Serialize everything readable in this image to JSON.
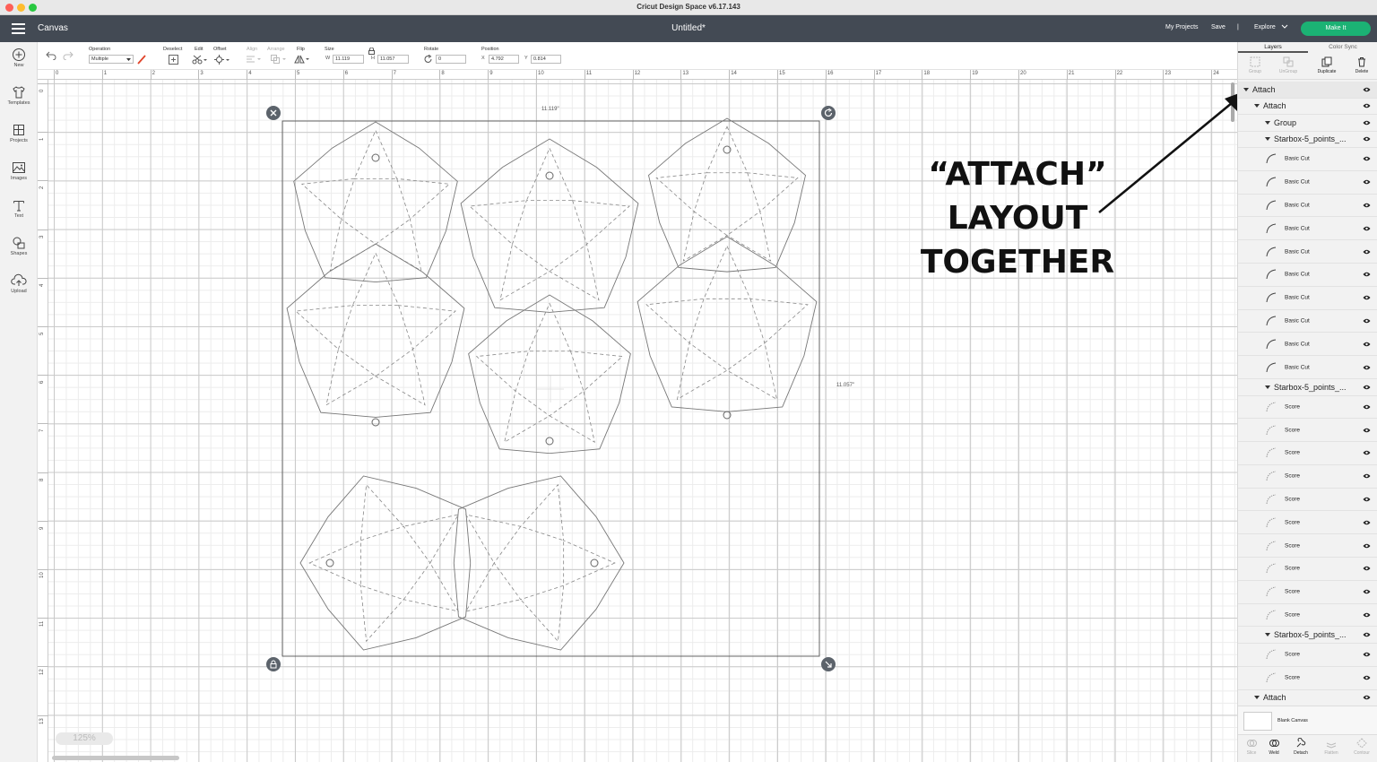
{
  "app": {
    "title": "Cricut Design Space  v6.17.143"
  },
  "topbar": {
    "canvas_label": "Canvas",
    "doc_title": "Untitled*",
    "my_projects": "My Projects",
    "save": "Save",
    "separator": "|",
    "explore": "Explore",
    "make_it": "Make It"
  },
  "sidebar": {
    "items": [
      {
        "label": "New",
        "icon": "plus-circle-icon"
      },
      {
        "label": "Templates",
        "icon": "shirt-icon"
      },
      {
        "label": "Projects",
        "icon": "projects-icon"
      },
      {
        "label": "Images",
        "icon": "image-icon"
      },
      {
        "label": "Text",
        "icon": "text-icon"
      },
      {
        "label": "Shapes",
        "icon": "shapes-icon"
      },
      {
        "label": "Upload",
        "icon": "cloud-upload-icon"
      }
    ]
  },
  "toolbar": {
    "operation_label": "Operation",
    "operation_value": "Multiple",
    "deselect": "Deselect",
    "edit": "Edit",
    "offset": "Offset",
    "align": "Align",
    "arrange": "Arrange",
    "flip": "Flip",
    "size_label": "Size",
    "w_label": "W",
    "w_value": "11.119",
    "h_label": "H",
    "h_value": "11.057",
    "rotate_label": "Rotate",
    "rotate_value": "0",
    "position_label": "Position",
    "x_label": "X",
    "x_value": "4.792",
    "y_label": "Y",
    "y_value": "0.814"
  },
  "rulers": {
    "top": [
      "0",
      "1",
      "2",
      "3",
      "4",
      "5",
      "6",
      "7",
      "8",
      "9",
      "10",
      "11",
      "12",
      "13",
      "14",
      "15",
      "16",
      "17",
      "18",
      "19",
      "20",
      "21",
      "22",
      "23",
      "24"
    ],
    "left": [
      "0",
      "1",
      "2",
      "3",
      "4",
      "5",
      "6",
      "7",
      "8",
      "9",
      "10",
      "11",
      "12",
      "13"
    ]
  },
  "canvas": {
    "width_dim": "11.119\"",
    "height_dim": "11.057\"",
    "zoom": "125%"
  },
  "annotation": {
    "lines": [
      "“ATTACH”",
      "LAYOUT",
      "TOGETHER"
    ]
  },
  "panel": {
    "tabs": [
      "Layers",
      "Color Sync"
    ],
    "tools": [
      "Group",
      "UnGroup",
      "Duplicate",
      "Delete"
    ],
    "layers": [
      {
        "label": "Attach",
        "type": "group",
        "indent": 0
      },
      {
        "label": "Attach",
        "type": "group",
        "indent": 1
      },
      {
        "label": "Group",
        "type": "group",
        "indent": 2
      },
      {
        "label": "Starbox-5_points_...",
        "type": "group",
        "indent": 2
      },
      {
        "label": "Basic Cut",
        "type": "item"
      },
      {
        "label": "Basic Cut",
        "type": "item"
      },
      {
        "label": "Basic Cut",
        "type": "item"
      },
      {
        "label": "Basic Cut",
        "type": "item"
      },
      {
        "label": "Basic Cut",
        "type": "item"
      },
      {
        "label": "Basic Cut",
        "type": "item"
      },
      {
        "label": "Basic Cut",
        "type": "item"
      },
      {
        "label": "Basic Cut",
        "type": "item"
      },
      {
        "label": "Basic Cut",
        "type": "item"
      },
      {
        "label": "Basic Cut",
        "type": "item"
      },
      {
        "label": "Starbox-5_points_...",
        "type": "group",
        "indent": 2
      },
      {
        "label": "Score",
        "type": "item"
      },
      {
        "label": "Score",
        "type": "item"
      },
      {
        "label": "Score",
        "type": "item"
      },
      {
        "label": "Score",
        "type": "item"
      },
      {
        "label": "Score",
        "type": "item"
      },
      {
        "label": "Score",
        "type": "item"
      },
      {
        "label": "Score",
        "type": "item"
      },
      {
        "label": "Score",
        "type": "item"
      },
      {
        "label": "Score",
        "type": "item"
      },
      {
        "label": "Score",
        "type": "item"
      },
      {
        "label": "Starbox-5_points_...",
        "type": "group",
        "indent": 2
      },
      {
        "label": "Score",
        "type": "item"
      },
      {
        "label": "Score",
        "type": "item"
      },
      {
        "label": "Attach",
        "type": "group",
        "indent": 1
      }
    ],
    "blank_canvas": "Blank Canvas",
    "bottom_tools": [
      "Slice",
      "Weld",
      "Detach",
      "Flatten",
      "Contour"
    ]
  },
  "colors": {
    "topbar": "#434a54",
    "make_it": "#1bb274",
    "line_color": "#e0442a"
  }
}
